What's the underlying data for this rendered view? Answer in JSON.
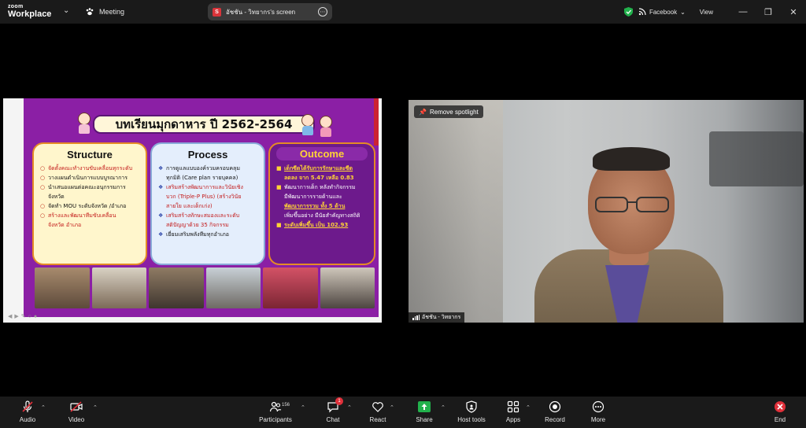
{
  "app": {
    "logo_line1": "zoom",
    "logo_line2": "Workplace"
  },
  "meeting": {
    "label": "Meeting"
  },
  "share_banner": {
    "badge": "S",
    "text": "อัชชัน - วิทยากร's screen"
  },
  "topbar_right": {
    "live_label": "Facebook",
    "view_label": "View"
  },
  "slide": {
    "title": "บทเรียนมุกดาหาร ปี 2562-2564",
    "structure": {
      "heading": "Structure",
      "items": [
        "จัดตั้งคณะทำงานขับเคลื่อนทุกระดับ",
        "วางแผนดำเนินการแบบบูรณาการ",
        "นำเสนอแผนต่อคณะอนุกรรมการ",
        "จังหวัด",
        "จัดทำ MOU ระดับจังหวัด /อำเภอ",
        "สร้างและพัฒนาทีมขับเคลื่อน",
        "จังหวัด อำเภอ"
      ]
    },
    "process": {
      "heading": "Process",
      "items": [
        "การดูแลแบบองค์รวมครอบคลุม",
        "ทุกมิติ (Care plan รายบุคคล)",
        "เสริมสร้างพัฒนาการและวินัยเชิง",
        "บวก (Triple-P Plus) (สร้างวินัย",
        "สายใย และเด็กเก่ง)",
        "เสริมสร้างทักษะสมองและระดับ",
        "สติปัญญาด้วย 35 กิจกรรม",
        "เยี่ยมเสริมพลังทีมทุกอำเภอ"
      ]
    },
    "outcome": {
      "heading": "Outcome",
      "items": [
        "เด็กซีดได้รับการรักษาและซีด",
        "ลดลง จาก 5.47 เหลือ 0.83",
        "พัฒนาการเด็ก หลังทำกิจกรรม",
        "มีพัฒนาการรายด้านและ",
        "พัฒนาการรวม ทั้ง 5 ด้าน",
        "เพิ่มขึ้นอย่าง มีนัยสำคัญทางสถิติ",
        "ระดับเพิ่มขึ้น เป็น 102.93"
      ]
    }
  },
  "camera": {
    "remove_spotlight": "Remove spotlight",
    "participant_name": "อัชชัน - วิทยากร"
  },
  "toolbar": {
    "audio": "Audio",
    "video": "Video",
    "participants": "Participants",
    "participants_count": "156",
    "chat": "Chat",
    "chat_badge": "1",
    "react": "React",
    "share": "Share",
    "host_tools": "Host tools",
    "apps": "Apps",
    "record": "Record",
    "more": "More",
    "end": "End"
  },
  "colors": {
    "slide_bg": "#8b1fa5",
    "share_green": "#22b14c",
    "end_red": "#e0303a"
  }
}
